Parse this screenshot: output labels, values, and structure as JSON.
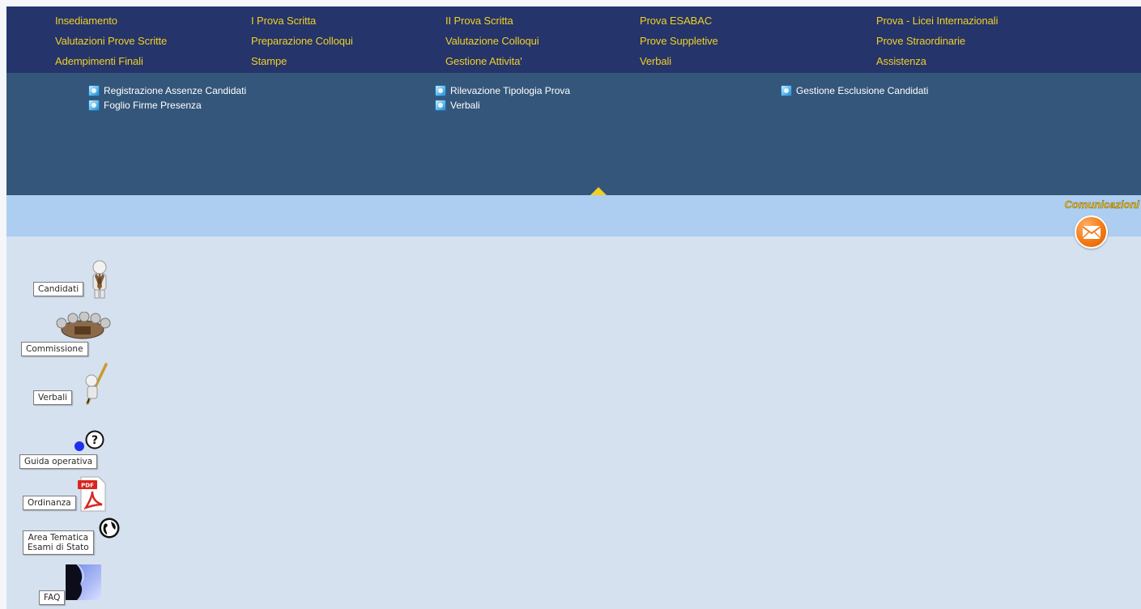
{
  "top_menu": {
    "col1": [
      "Insediamento",
      "Valutazioni Prove Scritte",
      "Adempimenti Finali"
    ],
    "col2": [
      "I Prova Scritta",
      "Preparazione Colloqui",
      "Stampe"
    ],
    "col3": [
      "II Prova Scritta",
      "Valutazione Colloqui",
      "Gestione Attivita'"
    ],
    "col4": [
      "Prova ESABAC",
      "Prove Suppletive",
      "Verbali"
    ],
    "col5": [
      "Prova - Licei Internazionali",
      "Prove Straordinarie",
      "Assistenza"
    ]
  },
  "submenu": {
    "items": [
      "Registrazione Assenze Candidati",
      "Foglio Firme Presenza",
      "Rilevazione Tipologia Prova",
      "Verbali",
      "Gestione Esclusione Candidati"
    ]
  },
  "comunicazioni": {
    "label": "Comunicazioni"
  },
  "sidebar": {
    "candidati": "Candidati",
    "commissione": "Commissione",
    "verbali": "Verbali",
    "guida": "Guida operativa",
    "ordinanza": "Ordinanza",
    "area_line1": "Area Tematica",
    "area_line2": "Esami di Stato",
    "faq": "FAQ"
  },
  "colors": {
    "nav_bg": "#25346b",
    "nav_text": "#f0d024",
    "submenu_bg": "#34567b",
    "comm_bar": "#adcef0",
    "content_bg": "#d5e1ef"
  }
}
